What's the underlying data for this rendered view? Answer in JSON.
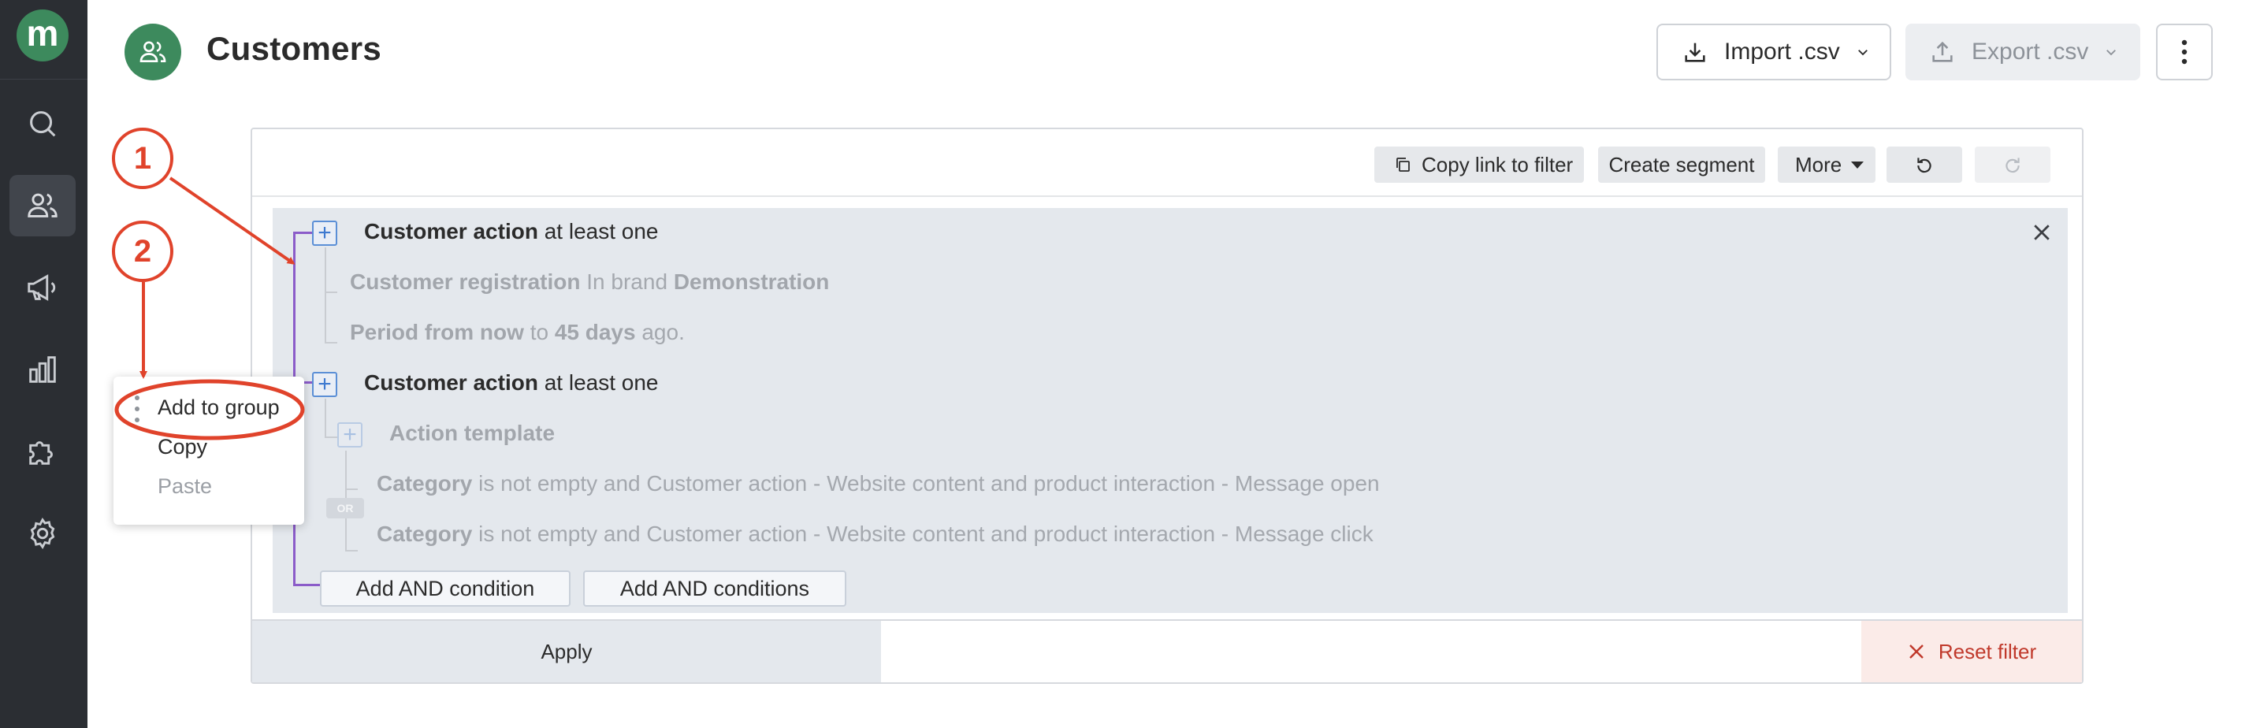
{
  "app": {
    "logo_letter": "m"
  },
  "sidebar": {
    "items": [
      {
        "name": "search",
        "icon": "search-icon"
      },
      {
        "name": "customers",
        "icon": "users-icon",
        "active": true
      },
      {
        "name": "campaigns",
        "icon": "megaphone-icon"
      },
      {
        "name": "analytics",
        "icon": "bar-chart-icon"
      },
      {
        "name": "integrations",
        "icon": "puzzle-icon"
      },
      {
        "name": "settings",
        "icon": "gear-icon"
      }
    ]
  },
  "header": {
    "title": "Customers",
    "import_label": "Import .csv",
    "export_label": "Export .csv"
  },
  "toolbar": {
    "copy_link": "Copy link to filter",
    "create_segment": "Create segment",
    "more": "More"
  },
  "filter": {
    "group1": {
      "title_bold": "Customer action",
      "title_rest": "at least one",
      "cond1_bold1": "Customer registration",
      "cond1_mid": "In brand",
      "cond1_bold2": "Demonstration",
      "cond2_bold1": "Period from now",
      "cond2_mid": "to",
      "cond2_bold2": "45 days",
      "cond2_tail": "ago."
    },
    "group2": {
      "title_bold": "Customer action",
      "title_rest": "at least one",
      "template": "Action template",
      "cond1_bold": "Category",
      "cond1_rest": "is not empty and Customer action - Website content and product interaction - Message open",
      "or_label": "OR",
      "cond2_bold": "Category",
      "cond2_rest": "is not empty and Customer action - Website content and product interaction - Message click"
    },
    "add_and_condition": "Add AND condition",
    "add_and_conditions": "Add AND conditions",
    "apply": "Apply",
    "reset": "Reset filter"
  },
  "context_menu": {
    "items": [
      {
        "label": "Add to group",
        "enabled": true
      },
      {
        "label": "Copy",
        "enabled": true
      },
      {
        "label": "Paste",
        "enabled": false
      }
    ]
  },
  "annotations": {
    "marker1": "1",
    "marker2": "2",
    "color": "#e0432b"
  },
  "colors": {
    "brand": "#3d8a5d",
    "sidebar": "#2b2e33",
    "bracket": "#8b5cc9",
    "reset": "#c0392b"
  }
}
